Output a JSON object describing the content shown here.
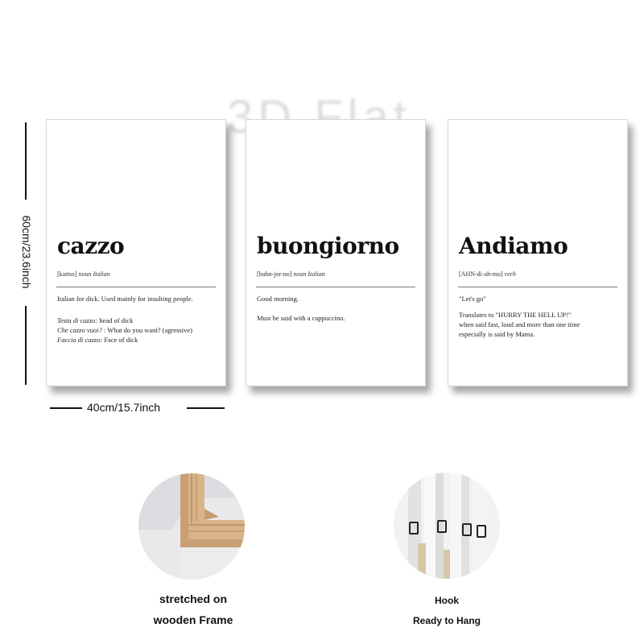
{
  "watermark": "3D Flat",
  "dimensions": {
    "height_label": "60cm/23.6inch",
    "width_label": "40cm/15.7inch"
  },
  "posters": [
    {
      "word": "cazzo",
      "pron": "[kattso]",
      "pos": "noun Italian",
      "lines": [
        "Italian for dick. Used mainly for insulting people."
      ],
      "examples": [
        {
          "it": "Testa di cazzo:",
          "en": " head of dick"
        },
        {
          "it": "Che cazzo vuoi?",
          "en": " : What do you want? (agressive)"
        },
        {
          "it": "Faccia di cazzo:",
          "en": " Face of dick"
        }
      ]
    },
    {
      "word": "buongiorno",
      "pron": "[buhn-jor-no]",
      "pos": "noun Italian",
      "lines": [
        "Good morning.",
        "Must be said with a cappuccino."
      ]
    },
    {
      "word": "Andiamo",
      "pron": "[AHN-di-ah-mo]",
      "pos": "verb",
      "lines": [
        "\"Let's go\"",
        "Translates to \"HURRY THE HELL UP!\"",
        "when said fast, loud and more than one time",
        "especially is said by Mama."
      ]
    }
  ],
  "features": [
    {
      "icon": "wooden-frame-photo",
      "caption_1": "stretched on",
      "caption_2": "wooden Frame"
    },
    {
      "icon": "hook-photo",
      "caption_1": "Hook",
      "caption_2": "Ready to Hang"
    }
  ],
  "colors": {
    "ink": "#111111",
    "wood": "#d8b48a",
    "wood_dark": "#b98c5e",
    "canvas": "#f4f4f4"
  }
}
